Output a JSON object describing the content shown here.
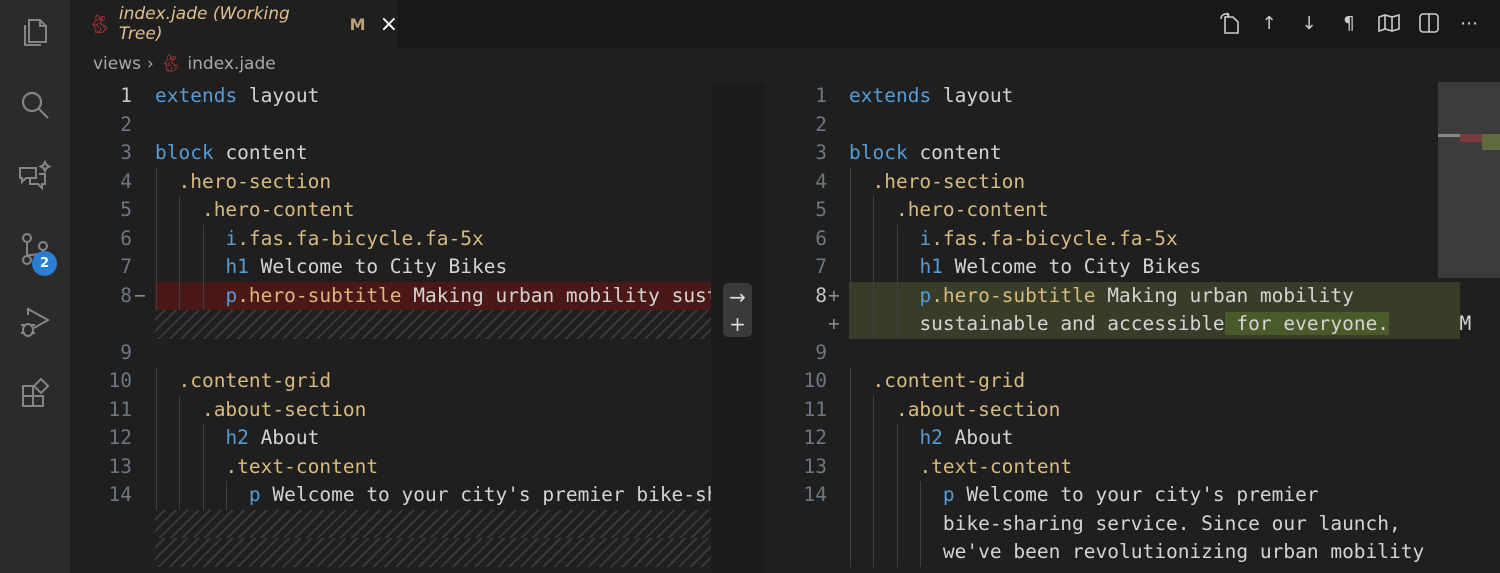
{
  "activity_bar": {
    "items": [
      "explorer-icon",
      "search-icon",
      "chat-sparkle-icon",
      "source-control-icon",
      "run-debug-icon",
      "extensions-icon"
    ],
    "scm_badge": "2"
  },
  "tab": {
    "title": "index.jade (Working Tree)",
    "status": "M",
    "close": "×",
    "icon": "rabbit-jade-icon",
    "title_color": "#e2c08d"
  },
  "editor_actions": [
    "open-file-icon",
    "previous-change-icon",
    "next-change-icon",
    "whitespace-icon",
    "minimap-icon",
    "split-editor-icon",
    "more-icon"
  ],
  "breadcrumb": {
    "folder": "views",
    "file": "index.jade"
  },
  "colors": {
    "deleted_bg": "#4b1818",
    "inserted_bg": "#373d29",
    "inserted_char_bg": "#4b5a2a",
    "keyword": "#569cd6",
    "selector": "#d7ba7d"
  },
  "diff_actions": {
    "revert": "→",
    "stage": "+"
  },
  "left": {
    "rows": [
      {
        "n": "1",
        "cur": true,
        "indent": 0,
        "t": [
          [
            "extends",
            "kw"
          ],
          [
            " layout",
            ""
          ]
        ]
      },
      {
        "n": "2",
        "indent": 0,
        "t": []
      },
      {
        "n": "3",
        "indent": 0,
        "t": [
          [
            "block",
            "kw"
          ],
          [
            " content",
            ""
          ]
        ]
      },
      {
        "n": "4",
        "indent": 1,
        "t": [
          [
            ".hero-section",
            "cls"
          ]
        ]
      },
      {
        "n": "5",
        "indent": 2,
        "t": [
          [
            ".hero-content",
            "cls"
          ]
        ]
      },
      {
        "n": "6",
        "indent": 3,
        "t": [
          [
            "i",
            "tag"
          ],
          [
            ".fas.fa-bicycle.fa-5x",
            "cls"
          ]
        ]
      },
      {
        "n": "7",
        "indent": 3,
        "t": [
          [
            "h1",
            "tag"
          ],
          [
            " Welcome to City Bikes",
            ""
          ]
        ]
      },
      {
        "n": "8",
        "mark": "−",
        "kind": "del",
        "indent": 3,
        "t": [
          [
            "p",
            "tag"
          ],
          [
            ".hero-subtitle",
            "cls"
          ],
          [
            " Making urban mobility sustainable and accessible.",
            ""
          ]
        ]
      },
      {
        "kind": "hatch"
      },
      {
        "n": "9",
        "indent": 0,
        "t": []
      },
      {
        "n": "10",
        "indent": 1,
        "t": [
          [
            ".content-grid",
            "cls"
          ]
        ]
      },
      {
        "n": "11",
        "indent": 2,
        "t": [
          [
            ".about-section",
            "cls"
          ]
        ]
      },
      {
        "n": "12",
        "indent": 3,
        "t": [
          [
            "h2",
            "tag"
          ],
          [
            " About",
            ""
          ]
        ]
      },
      {
        "n": "13",
        "indent": 3,
        "t": [
          [
            ".text-content",
            "cls"
          ]
        ]
      },
      {
        "n": "14",
        "indent": 4,
        "t": [
          [
            "p",
            "tag"
          ],
          [
            " Welcome to your city's premier bike-sharing service.",
            ""
          ]
        ]
      },
      {
        "kind": "hatch"
      },
      {
        "kind": "hatch"
      }
    ]
  },
  "right": {
    "rows": [
      {
        "n": "1",
        "indent": 0,
        "t": [
          [
            "extends",
            "kw"
          ],
          [
            " layout",
            ""
          ]
        ]
      },
      {
        "n": "2",
        "indent": 0,
        "t": []
      },
      {
        "n": "3",
        "indent": 0,
        "t": [
          [
            "block",
            "kw"
          ],
          [
            " content",
            ""
          ]
        ]
      },
      {
        "n": "4",
        "indent": 1,
        "t": [
          [
            ".hero-section",
            "cls"
          ]
        ]
      },
      {
        "n": "5",
        "indent": 2,
        "t": [
          [
            ".hero-content",
            "cls"
          ]
        ]
      },
      {
        "n": "6",
        "indent": 3,
        "t": [
          [
            "i",
            "tag"
          ],
          [
            ".fas.fa-bicycle.fa-5x",
            "cls"
          ]
        ]
      },
      {
        "n": "7",
        "indent": 3,
        "t": [
          [
            "h1",
            "tag"
          ],
          [
            " Welcome to City Bikes",
            ""
          ]
        ]
      },
      {
        "n": "8",
        "cur": true,
        "mark": "+",
        "kind": "ins",
        "indent": 3,
        "t": [
          [
            "p",
            "tag"
          ],
          [
            ".hero-subtitle",
            "cls"
          ],
          [
            " Making urban mobility",
            ""
          ]
        ]
      },
      {
        "n": "",
        "mark": "+",
        "kind": "ins",
        "indent": 3,
        "t": [
          [
            "sustainable and accessible",
            ""
          ],
          [
            " for everyone.",
            "chg"
          ],
          [
            "      M",
            ""
          ]
        ]
      },
      {
        "n": "9",
        "indent": 0,
        "t": []
      },
      {
        "n": "10",
        "indent": 1,
        "t": [
          [
            ".content-grid",
            "cls"
          ]
        ]
      },
      {
        "n": "11",
        "indent": 2,
        "t": [
          [
            ".about-section",
            "cls"
          ]
        ]
      },
      {
        "n": "12",
        "indent": 3,
        "t": [
          [
            "h2",
            "tag"
          ],
          [
            " About",
            ""
          ]
        ]
      },
      {
        "n": "13",
        "indent": 3,
        "t": [
          [
            ".text-content",
            "cls"
          ]
        ]
      },
      {
        "n": "14",
        "indent": 4,
        "t": [
          [
            "p",
            "tag"
          ],
          [
            " Welcome to your city's premier",
            ""
          ]
        ]
      },
      {
        "n": "",
        "indent": 4,
        "t": [
          [
            "bike-sharing service. Since our launch,",
            ""
          ]
        ]
      },
      {
        "n": "",
        "indent": 4,
        "t": [
          [
            "we've been revolutionizing urban mobility",
            ""
          ]
        ]
      }
    ]
  }
}
